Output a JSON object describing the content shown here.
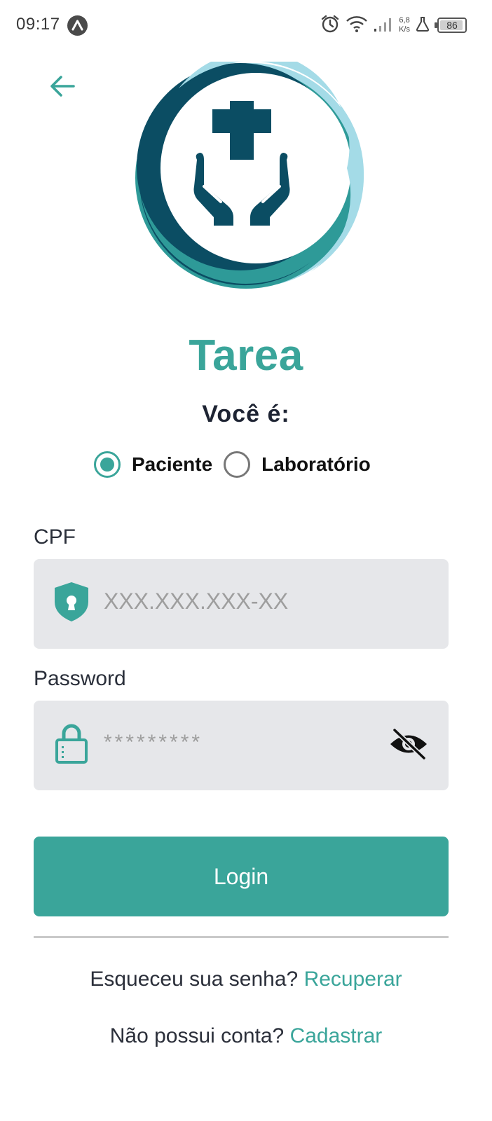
{
  "status_bar": {
    "time": "09:17",
    "app_icon": "Λ",
    "net_speed_value": "6,8",
    "net_speed_unit": "K/s",
    "battery_level": "86",
    "icons": [
      "alarm-icon",
      "wifi-icon",
      "signal-icon",
      "flask-icon",
      "battery-icon"
    ]
  },
  "header": {
    "back_icon": "arrow-left-icon"
  },
  "brand": {
    "logo": "medical-hands-cross-logo",
    "title": "Tarea"
  },
  "role": {
    "question": "Você é:",
    "options": [
      {
        "label": "Paciente",
        "selected": true
      },
      {
        "label": "Laboratório",
        "selected": false
      }
    ]
  },
  "form": {
    "cpf": {
      "label": "CPF",
      "placeholder": "XXX.XXX.XXX-XX",
      "value": "",
      "icon": "shield-lock-icon"
    },
    "password": {
      "label": "Password",
      "placeholder": "*********",
      "value": "",
      "icon": "lock-icon",
      "toggle_icon": "eye-off-icon"
    },
    "login_label": "Login"
  },
  "footer": {
    "forgot_text": "Esqueceu sua senha?",
    "forgot_link": "Recuperar",
    "signup_text": "Não possui conta?",
    "signup_link": "Cadastrar"
  },
  "colors": {
    "accent": "#3aa59a",
    "dark_teal": "#0b4d63",
    "light_teal": "#a4dbe7",
    "field_bg": "#e6e7ea",
    "text_dark": "#1e2433"
  }
}
